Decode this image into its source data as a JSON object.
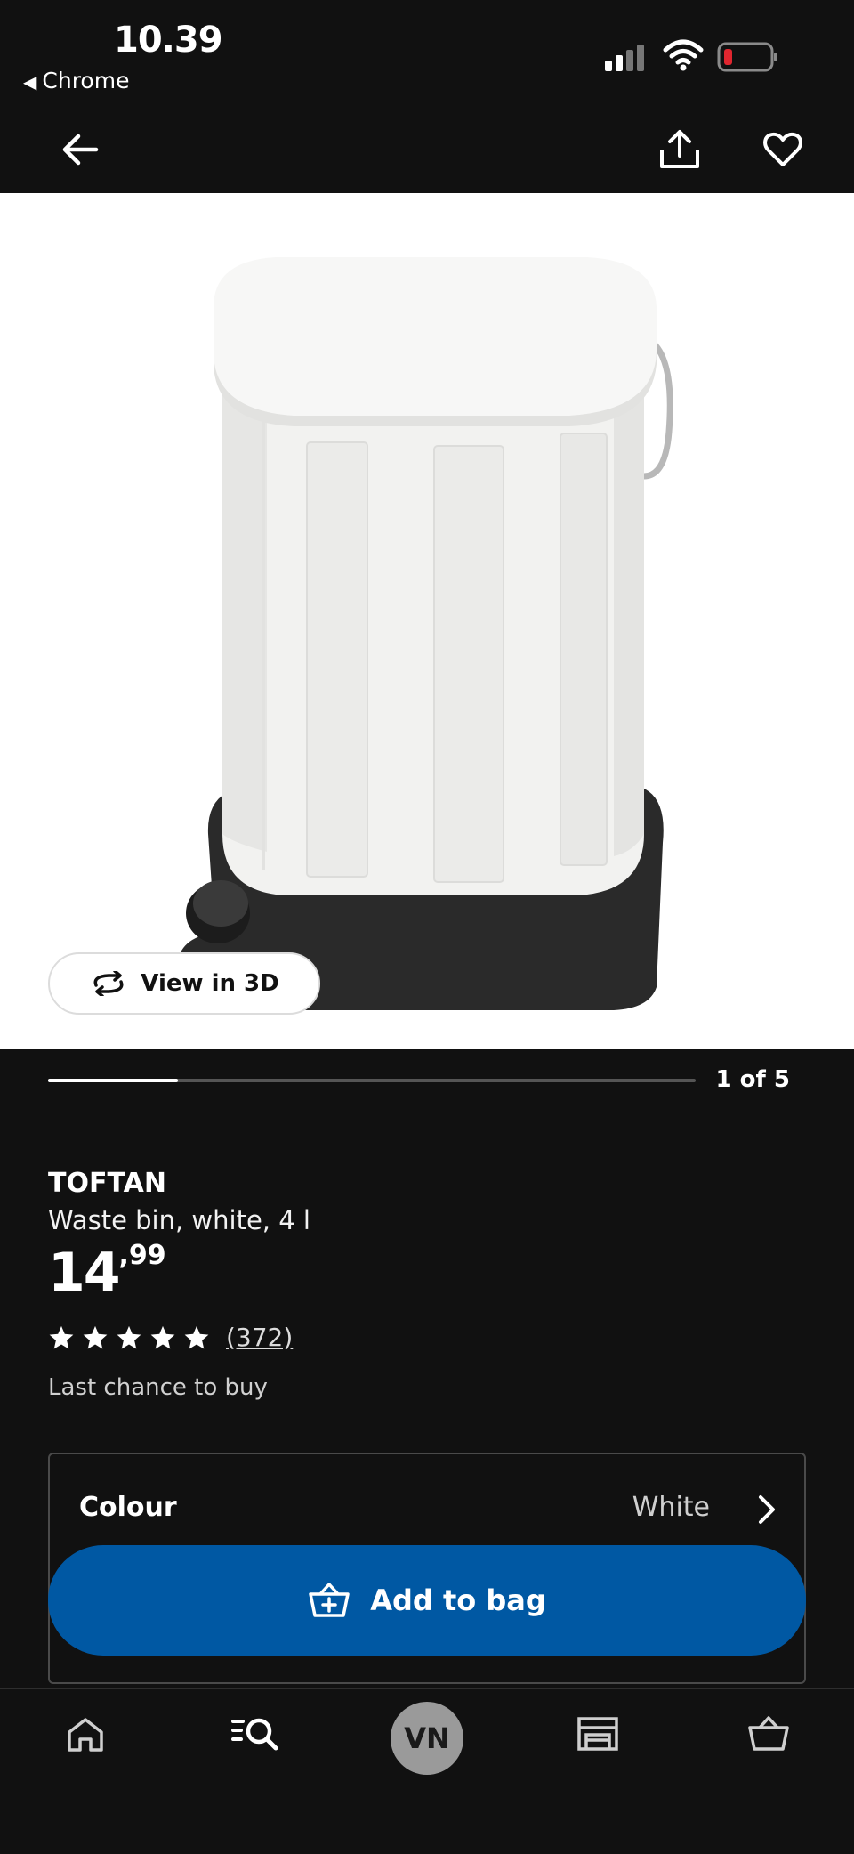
{
  "status_bar": {
    "time": "10.39",
    "back_app": "Chrome"
  },
  "header": {
    "back_icon": "arrow-left-icon",
    "share_icon": "share-icon",
    "favourite_icon": "heart-outline-icon"
  },
  "gallery": {
    "view_3d_label": "View in 3D",
    "counter": "1 of 5",
    "progress_fraction": 0.2
  },
  "product": {
    "name": "TOFTAN",
    "description": "Waste bin, white, 4 l",
    "price_int": "14",
    "price_dec": ",99",
    "rating_stars": 5,
    "review_count": "(372)",
    "availability": "Last chance to buy"
  },
  "colour": {
    "label": "Colour",
    "value": "White"
  },
  "cta": {
    "add_to_bag": "Add to bag"
  },
  "bottom_nav": {
    "items": [
      "home-icon",
      "search-list-icon",
      "profile-avatar",
      "store-icon",
      "basket-icon"
    ],
    "avatar_initials": "VN"
  },
  "colors": {
    "background": "#111111",
    "accent_blue": "#0058a3",
    "text": "#ffffff",
    "image_bg": "#ffffff"
  }
}
